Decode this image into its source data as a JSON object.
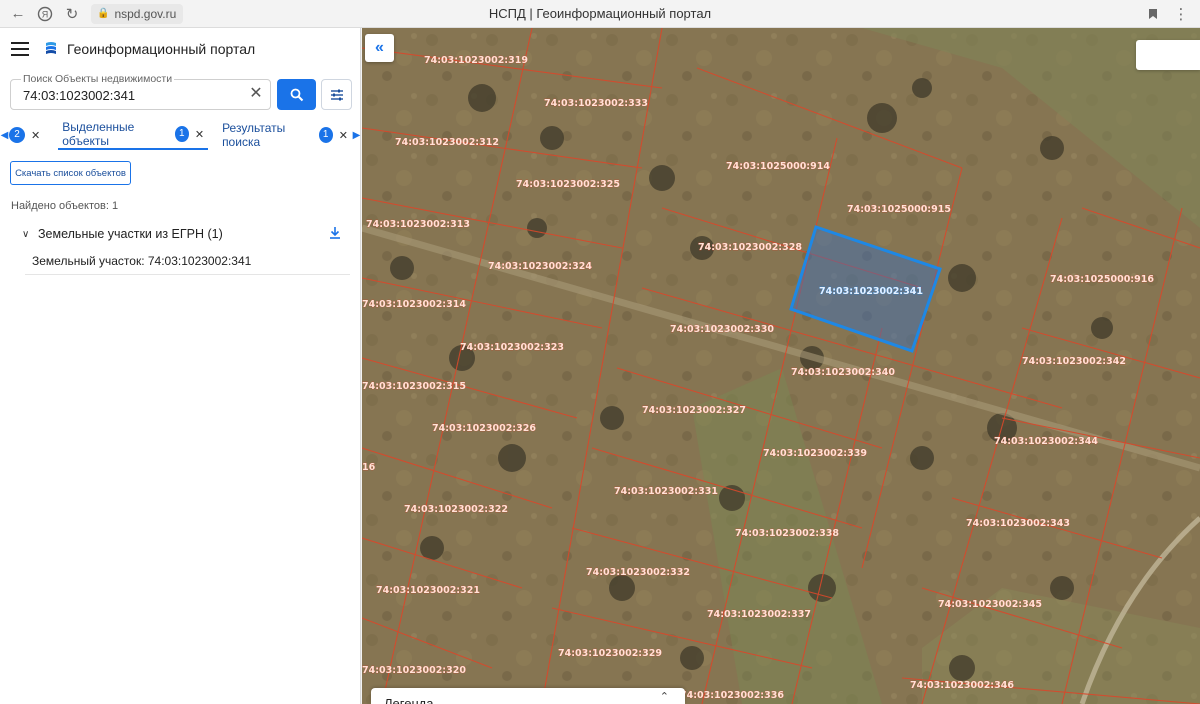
{
  "browser": {
    "url": "nspd.gov.ru",
    "tab_title": "НСПД | Геоинформационный портал"
  },
  "app": {
    "title": "Геоинформационный портал"
  },
  "search": {
    "label": "Поиск Объекты недвижимости",
    "value": "74:03:1023002:341"
  },
  "tabs": [
    {
      "label": "",
      "badge": "2"
    },
    {
      "label": "Выделенные объекты",
      "badge": "1",
      "active": true
    },
    {
      "label": "Результаты поиска",
      "badge": "1"
    }
  ],
  "results": {
    "download_list_label": "Скачать список объектов",
    "found_count": "Найдено объектов: 1",
    "group_label": "Земельные участки из ЕГРН (1)",
    "item_label": "Земельный участок: 74:03:1023002:341"
  },
  "map": {
    "collapse_icon": "double-chevron-left-icon",
    "legend_label": "Легенда",
    "selected_parcel": "74:03:1023002:341",
    "highlight_color": "#1e88e5",
    "boundary_color": "#d9482b",
    "parcels": [
      "74:03:1023002:319",
      "74:03:1023002:333",
      "74:03:1023002:312",
      "74:03:1023002:325",
      "74:03:1025000:914",
      "74:03:1025000:915",
      "74:03:1023002:313",
      "74:03:1023002:328",
      "74:03:1023002:324",
      "74:03:1023002:341",
      "74:03:1025000:916",
      "74:03:1023002:314",
      "74:03:1023002:330",
      "74:03:1023002:323",
      "74:03:1023002:342",
      "74:03:1023002:340",
      "74:03:1023002:315",
      "74:03:1023002:327",
      "74:03:1023002:326",
      "74:03:1023002:344",
      "74:03:1023002:339",
      "16",
      "74:03:1023002:331",
      "74:03:1023002:322",
      "74:03:1023002:343",
      "74:03:1023002:338",
      "74:03:1023002:332",
      "74:03:1023002:321",
      "74:03:1023002:345",
      "74:03:1023002:337",
      "74:03:1023002:329",
      "74:03:1023002:320",
      "74:03:1023002:346",
      "74:03:1023002:336"
    ]
  },
  "colors": {
    "accent": "#1a73e8",
    "link": "#1b4f9c"
  }
}
